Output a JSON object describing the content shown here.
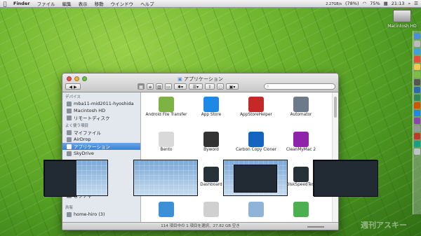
{
  "menubar": {
    "apple": "",
    "items": [
      "Finder",
      "ファイル",
      "編集",
      "表示",
      "移動",
      "ウインドウ",
      "ヘルプ"
    ],
    "status_text": "2.27GB/s",
    "battery": "(78%)",
    "percent": "75%",
    "clock": "21:13"
  },
  "desktop": {
    "hd_label": "Macintosh HD",
    "watermark": "週刊アスキー"
  },
  "window": {
    "title": "アプリケーション",
    "sidebar": {
      "devices_header": "デバイス",
      "devices": [
        "mba11-mid2011-hyoshida",
        "Macintosh HD",
        "リモートディスク"
      ],
      "favorites_header": "よく使う項目",
      "favorites": [
        "マイファイル",
        "AirDrop",
        "アプリケーション",
        "SkyDrive",
        "ピクチャ"
      ],
      "shared_header": "共有",
      "shared": [
        "home-hiro (3)"
      ]
    },
    "apps": [
      {
        "name": "Android File Transfer",
        "color": "#7cb342"
      },
      {
        "name": "App Store",
        "color": "#1e88e5"
      },
      {
        "name": "AppStoreHelper",
        "color": "#c62828"
      },
      {
        "name": "Automator",
        "color": "#6d7a8a"
      },
      {
        "name": "Bento",
        "color": "#d9d9d9"
      },
      {
        "name": "Byword",
        "color": "#333333"
      },
      {
        "name": "Carbon Copy Cloner",
        "color": "#1565c0"
      },
      {
        "name": "CleanMyMac 2",
        "color": "#8e24aa"
      },
      {
        "name": "",
        "color": "#eeeeee"
      },
      {
        "name": "Dashboard",
        "color": "#263238"
      },
      {
        "name": "",
        "color": "#eeeeee"
      },
      {
        "name": "DiskSpeedTest",
        "color": "#263238"
      },
      {
        "name": "",
        "color": "#3d8fd6"
      },
      {
        "name": "",
        "color": "#d0d0d0"
      },
      {
        "name": "",
        "color": "#8fb3d9"
      },
      {
        "name": "",
        "color": "#4caf50"
      }
    ],
    "status": "114 項目中の 1 項目を選択、27.82 GB 空き"
  }
}
